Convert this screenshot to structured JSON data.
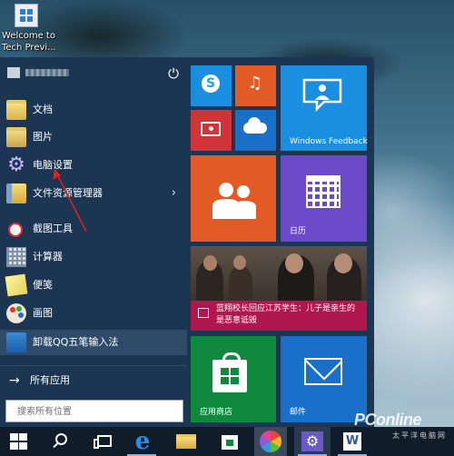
{
  "desktop": {
    "icon_label": "Welcome to Tech Previ..."
  },
  "start_menu": {
    "user": {
      "name": ""
    },
    "items": [
      {
        "label": "文档"
      },
      {
        "label": "图片"
      },
      {
        "label": "电脑设置"
      },
      {
        "label": "文件资源管理器"
      },
      {
        "label": "截图工具"
      },
      {
        "label": "计算器"
      },
      {
        "label": "便笺"
      },
      {
        "label": "画图"
      },
      {
        "label": "卸载QQ五笔输入法"
      }
    ],
    "all_apps_label": "所有应用",
    "search_placeholder": "搜索所有位置"
  },
  "tiles": {
    "feedback_label": "Windows Feedback",
    "calendar_label": "日历",
    "news_headline": "蓝翔校长回应江苏学生：儿子是亲生的 是恶意诋毁",
    "store_label": "应用商店",
    "mail_label": "邮件"
  },
  "colors": {
    "menu_bg": "#1b3553",
    "tile_blue": "#1a8fe0",
    "tile_orange": "#e25a26",
    "tile_red": "#d13438",
    "tile_purple": "#6b49c8",
    "tile_news": "#b0184d",
    "tile_green": "#10893e",
    "taskbar_bg": "#101c2a",
    "annotation_arrow": "#e0211d"
  },
  "taskbar": {
    "icons": [
      "start-icon",
      "search-icon",
      "task-view-icon",
      "internet-explorer-icon",
      "file-explorer-icon",
      "store-icon",
      "photos-icon",
      "settings-icon",
      "word-icon"
    ]
  },
  "watermark": {
    "brand": "PConline",
    "sub": "太平洋电脑网"
  }
}
